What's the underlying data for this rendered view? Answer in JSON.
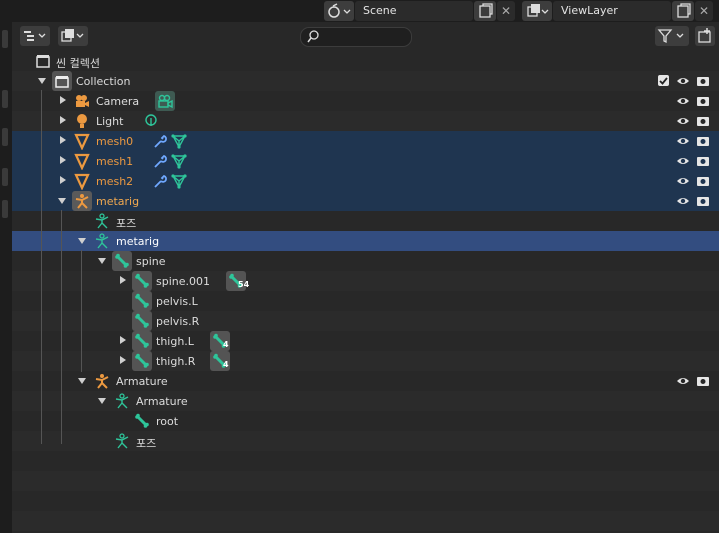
{
  "topbar": {
    "scene": "Scene",
    "view_layer": "ViewLayer"
  },
  "outliner": {
    "root_label": "씬 컬렉션",
    "rows": [
      {
        "label": "Collection"
      },
      {
        "label": "Camera"
      },
      {
        "label": "Light"
      },
      {
        "label": "mesh0"
      },
      {
        "label": "mesh1"
      },
      {
        "label": "mesh2"
      },
      {
        "label": "metarig"
      },
      {
        "label": "포즈"
      },
      {
        "label": "metarig"
      },
      {
        "label": "spine"
      },
      {
        "label": "spine.001",
        "badge": "54"
      },
      {
        "label": "pelvis.L"
      },
      {
        "label": "pelvis.R"
      },
      {
        "label": "thigh.L",
        "badge": "4"
      },
      {
        "label": "thigh.R",
        "badge": "4"
      },
      {
        "label": "Armature"
      },
      {
        "label": "Armature"
      },
      {
        "label": "root"
      },
      {
        "label": "포즈"
      }
    ]
  },
  "colors": {
    "selected_row": "#1f3550",
    "active_row": "#334d80",
    "object_orange": "#ec9940",
    "bone_green": "#2ec59a"
  }
}
